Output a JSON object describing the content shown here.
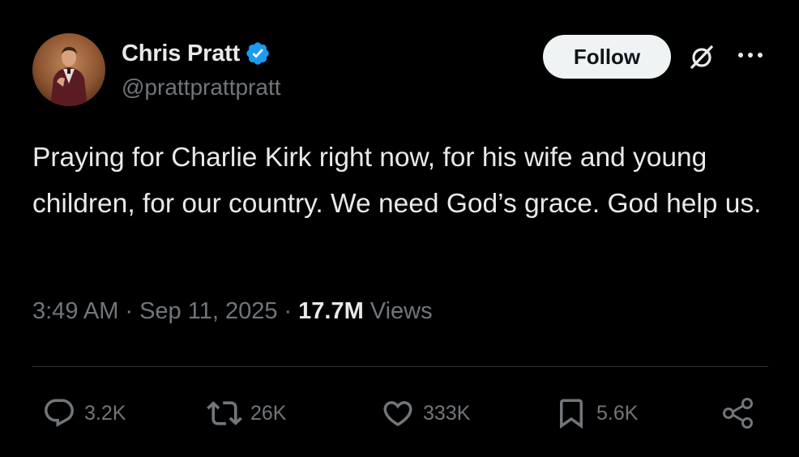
{
  "author": {
    "display_name": "Chris Pratt",
    "handle": "@prattprattpratt",
    "verified": true
  },
  "header": {
    "follow_label": "Follow"
  },
  "tweet": {
    "text": "Praying for Charlie Kirk right now, for his wife and young children, for our country. We need God’s grace. God help us.",
    "time": "3:49 AM",
    "date": "Sep 11, 2025",
    "views_count": "17.7M",
    "views_label": "Views"
  },
  "actions": {
    "replies": "3.2K",
    "reposts": "26K",
    "likes": "333K",
    "bookmarks": "5.6K"
  },
  "icons": {
    "verified": "verified-badge-icon",
    "grok": "grok-icon",
    "more": "more-icon",
    "reply": "reply-icon",
    "repost": "repost-icon",
    "like": "heart-icon",
    "bookmark": "bookmark-icon",
    "share": "share-icon"
  },
  "colors": {
    "background": "#000000",
    "text_primary": "#e7e9ea",
    "text_secondary": "#71767b",
    "verified_blue": "#1d9bf0",
    "follow_bg": "#eff3f4",
    "divider": "#2f3336"
  }
}
